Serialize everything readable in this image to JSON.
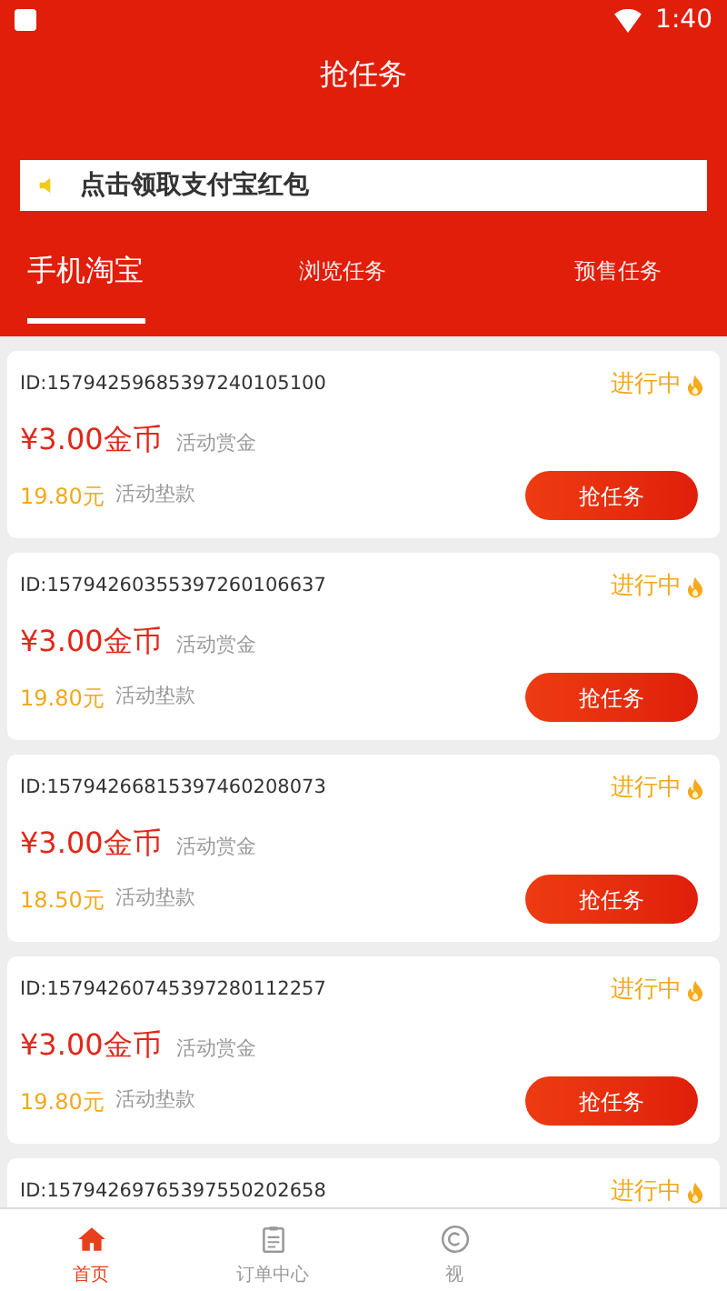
{
  "status_bar": {
    "time": "1:40"
  },
  "title": "抢任务",
  "notice": {
    "text": "点击领取支付宝红包"
  },
  "tabs": [
    {
      "label": "手机淘宝",
      "selected": true
    },
    {
      "label": "浏览任务",
      "selected": false
    },
    {
      "label": "预售任务",
      "selected": false
    }
  ],
  "tasks": [
    {
      "id": "ID:15794259685397240105100",
      "status": "进行中",
      "reward": "¥3.00金币",
      "reward_label": "活动赏金",
      "advance": "19.80元",
      "advance_label": "活动垫款",
      "button": "抢任务"
    },
    {
      "id": "ID:15794260355397260106637",
      "status": "进行中",
      "reward": "¥3.00金币",
      "reward_label": "活动赏金",
      "advance": "19.80元",
      "advance_label": "活动垫款",
      "button": "抢任务"
    },
    {
      "id": "ID:15794266815397460208073",
      "status": "进行中",
      "reward": "¥3.00金币",
      "reward_label": "活动赏金",
      "advance": "18.50元",
      "advance_label": "活动垫款",
      "button": "抢任务"
    },
    {
      "id": "ID:15794260745397280112257",
      "status": "进行中",
      "reward": "¥3.00金币",
      "reward_label": "活动赏金",
      "advance": "19.80元",
      "advance_label": "活动垫款",
      "button": "抢任务"
    },
    {
      "id": "ID:15794269765397550202658",
      "status": "进行中"
    }
  ],
  "nav": [
    {
      "label": "首页",
      "selected": true
    },
    {
      "label": "订单中心",
      "selected": false
    },
    {
      "label": "视",
      "selected": false
    }
  ]
}
